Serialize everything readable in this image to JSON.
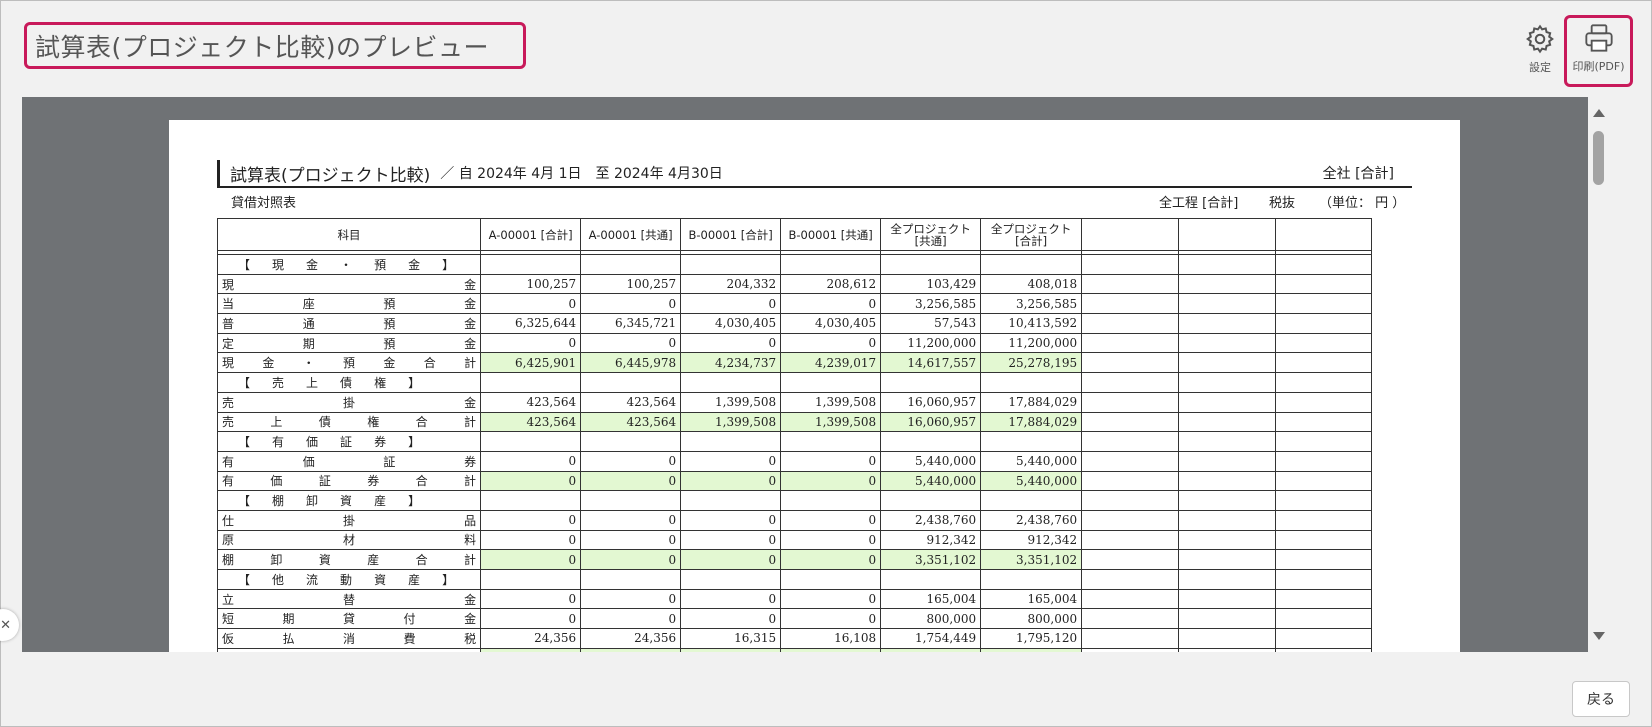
{
  "header": {
    "title": "試算表(プロジェクト比較)のプレビュー",
    "settings_label": "設定",
    "print_label": "印刷(PDF)"
  },
  "document": {
    "title": "試算表(プロジェクト比較)",
    "period": "／ 自 2024年 4月 1日　至 2024年 4月30日",
    "company": "全社 [合計]",
    "subtitle": "貸借対照表",
    "process": "全工程 [合計]",
    "tax": "税抜",
    "unit": "（単位： 円 ）",
    "columns": [
      "科目",
      "A-00001 [合計]",
      "A-00001 [共通]",
      "B-00001 [合計]",
      "B-00001 [共通]",
      "全プロジェクト\n[共通]",
      "全プロジェクト\n[合計]",
      "",
      "",
      ""
    ],
    "rows": [
      {
        "type": "heading",
        "chars": [
          "【",
          "現",
          "金",
          "・",
          "預",
          "金",
          "】"
        ]
      },
      {
        "type": "item",
        "chars": [
          "現",
          "金"
        ],
        "values": [
          "100,257",
          "100,257",
          "204,332",
          "208,612",
          "103,429",
          "408,018"
        ]
      },
      {
        "type": "item",
        "chars": [
          "当",
          "座",
          "預",
          "金"
        ],
        "values": [
          "0",
          "0",
          "0",
          "0",
          "3,256,585",
          "3,256,585"
        ]
      },
      {
        "type": "item",
        "chars": [
          "普",
          "通",
          "預",
          "金"
        ],
        "values": [
          "6,325,644",
          "6,345,721",
          "4,030,405",
          "4,030,405",
          "57,543",
          "10,413,592"
        ]
      },
      {
        "type": "item",
        "chars": [
          "定",
          "期",
          "預",
          "金"
        ],
        "values": [
          "0",
          "0",
          "0",
          "0",
          "11,200,000",
          "11,200,000"
        ]
      },
      {
        "type": "total",
        "chars": [
          "現",
          "金",
          "・",
          "預",
          "金",
          "合",
          "計"
        ],
        "values": [
          "6,425,901",
          "6,445,978",
          "4,234,737",
          "4,239,017",
          "14,617,557",
          "25,278,195"
        ]
      },
      {
        "type": "heading",
        "chars": [
          "【",
          "売",
          "上",
          "債",
          "権",
          "】"
        ]
      },
      {
        "type": "item",
        "chars": [
          "売",
          "掛",
          "金"
        ],
        "values": [
          "423,564",
          "423,564",
          "1,399,508",
          "1,399,508",
          "16,060,957",
          "17,884,029"
        ]
      },
      {
        "type": "total",
        "chars": [
          "売",
          "上",
          "債",
          "権",
          "合",
          "計"
        ],
        "values": [
          "423,564",
          "423,564",
          "1,399,508",
          "1,399,508",
          "16,060,957",
          "17,884,029"
        ]
      },
      {
        "type": "heading",
        "chars": [
          "【",
          "有",
          "価",
          "証",
          "券",
          "】"
        ]
      },
      {
        "type": "item",
        "chars": [
          "有",
          "価",
          "証",
          "券"
        ],
        "values": [
          "0",
          "0",
          "0",
          "0",
          "5,440,000",
          "5,440,000"
        ]
      },
      {
        "type": "total",
        "chars": [
          "有",
          "価",
          "証",
          "券",
          "合",
          "計"
        ],
        "values": [
          "0",
          "0",
          "0",
          "0",
          "5,440,000",
          "5,440,000"
        ]
      },
      {
        "type": "heading",
        "chars": [
          "【",
          "棚",
          "卸",
          "資",
          "産",
          "】"
        ]
      },
      {
        "type": "item",
        "chars": [
          "仕",
          "掛",
          "品"
        ],
        "values": [
          "0",
          "0",
          "0",
          "0",
          "2,438,760",
          "2,438,760"
        ]
      },
      {
        "type": "item",
        "chars": [
          "原",
          "材",
          "料"
        ],
        "values": [
          "0",
          "0",
          "0",
          "0",
          "912,342",
          "912,342"
        ]
      },
      {
        "type": "total",
        "chars": [
          "棚",
          "卸",
          "資",
          "産",
          "合",
          "計"
        ],
        "values": [
          "0",
          "0",
          "0",
          "0",
          "3,351,102",
          "3,351,102"
        ]
      },
      {
        "type": "heading",
        "chars": [
          "【",
          "他",
          "流",
          "動",
          "資",
          "産",
          "】"
        ]
      },
      {
        "type": "item",
        "chars": [
          "立",
          "替",
          "金"
        ],
        "values": [
          "0",
          "0",
          "0",
          "0",
          "165,004",
          "165,004"
        ]
      },
      {
        "type": "item",
        "chars": [
          "短",
          "期",
          "貸",
          "付",
          "金"
        ],
        "values": [
          "0",
          "0",
          "0",
          "0",
          "800,000",
          "800,000"
        ]
      },
      {
        "type": "item",
        "chars": [
          "仮",
          "払",
          "消",
          "費",
          "税"
        ],
        "values": [
          "24,356",
          "24,356",
          "16,315",
          "16,108",
          "1,754,449",
          "1,795,120"
        ]
      },
      {
        "type": "total",
        "chars": [],
        "values": [
          "",
          "",
          "",
          "",
          "",
          ""
        ]
      }
    ]
  },
  "footer": {
    "back_label": "戻る"
  },
  "icons": {
    "settings": "gear-icon",
    "print": "printer-icon",
    "side_close": "close-icon"
  },
  "colors": {
    "highlight_border": "#c81a5a",
    "total_row_fill": "#e3f8d2",
    "viewer_bg": "#6f7275"
  }
}
